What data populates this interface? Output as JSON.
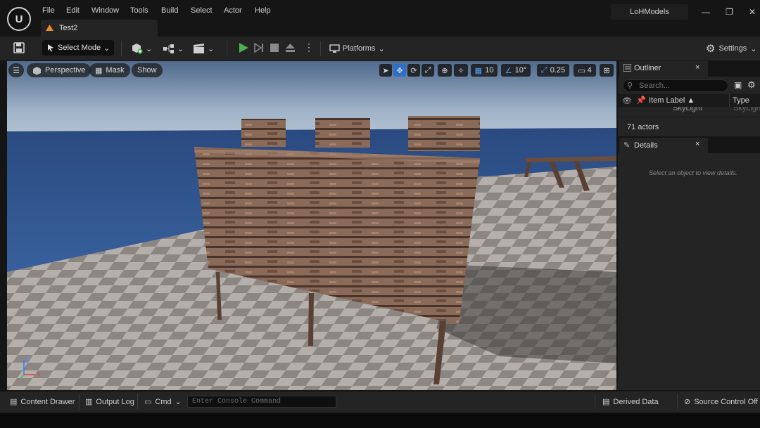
{
  "app": {
    "logo_glyph": "U",
    "project": "LoHModels"
  },
  "menu": [
    "File",
    "Edit",
    "Window",
    "Tools",
    "Build",
    "Select",
    "Actor",
    "Help"
  ],
  "tab": {
    "label": "Test2"
  },
  "window_controls": {
    "minimize": "—",
    "restore": "❐",
    "close": "✕"
  },
  "toolbar": {
    "select_mode": "Select Mode",
    "platforms": "Platforms",
    "settings": "Settings"
  },
  "viewport": {
    "perspective": "Perspective",
    "mask": "Mask",
    "show": "Show",
    "grid_snap": "10",
    "rotation_snap": "10°",
    "scale_snap": "0.25",
    "camera_speed": "4"
  },
  "outliner": {
    "title": "Outliner",
    "search_placeholder": "Search...",
    "col_label": "Item Label ▲",
    "col_type": "Type",
    "row_label": "SkyLight",
    "row_type": "SkyLight",
    "actor_count": "71 actors"
  },
  "details": {
    "title": "Details",
    "empty_message": "Select an object to view details."
  },
  "bottom": {
    "content_drawer": "Content Drawer",
    "output_log": "Output Log",
    "cmd": "Cmd",
    "console_placeholder": "Enter Console Command",
    "derived_data": "Derived Data",
    "source_control": "Source Control Off"
  },
  "axis": {
    "x": "X",
    "z": "Z"
  },
  "colors": {
    "accent_orange": "#f08a24",
    "play_green": "#4caf50",
    "active_blue": "#2e6fc7"
  }
}
